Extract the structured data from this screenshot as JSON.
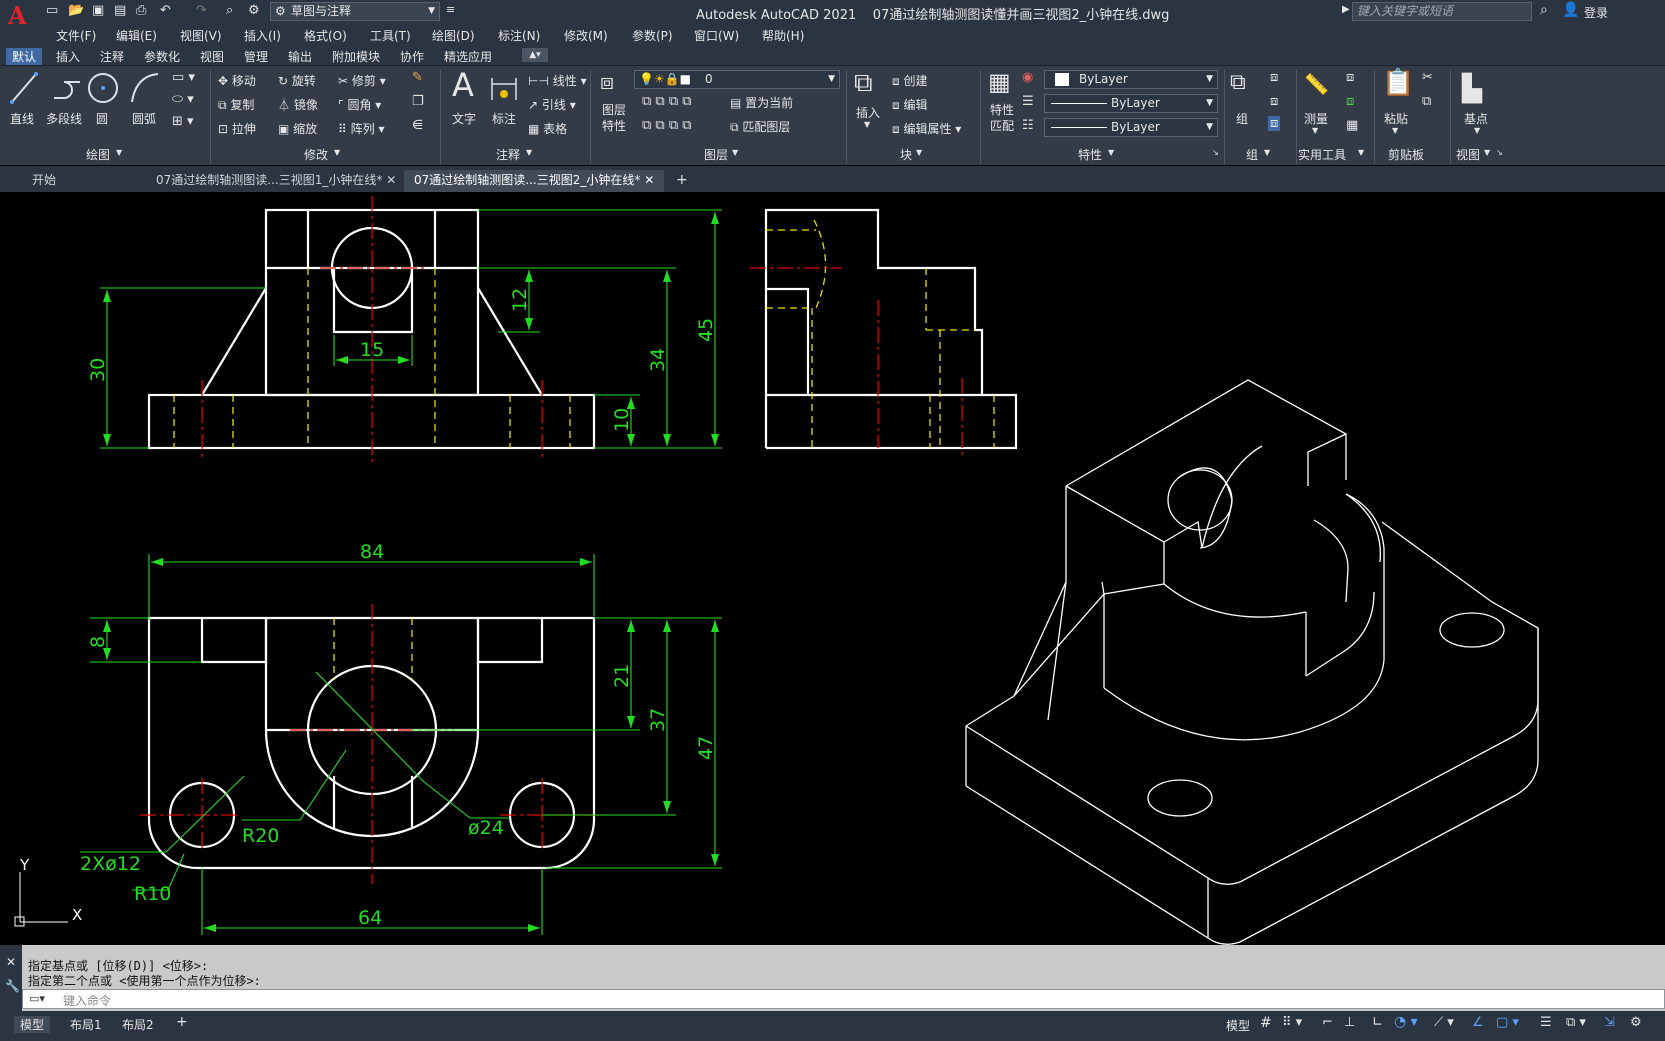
{
  "titlebar": {
    "workspace": "草图与注释",
    "title": "Autodesk AutoCAD 2021    07通过绘制轴测图读懂并画三视图2_小钟在线.dwg",
    "search_placeholder": "键入关键字或短语",
    "login": "登录"
  },
  "menu": [
    "文件(F)",
    "编辑(E)",
    "视图(V)",
    "插入(I)",
    "格式(O)",
    "工具(T)",
    "绘图(D)",
    "标注(N)",
    "修改(M)",
    "参数(P)",
    "窗口(W)",
    "帮助(H)"
  ],
  "ribbon_tabs": [
    "默认",
    "插入",
    "注释",
    "参数化",
    "视图",
    "管理",
    "输出",
    "附加模块",
    "协作",
    "精选应用"
  ],
  "ribbon": {
    "draw": {
      "line": "直线",
      "polyline": "多段线",
      "circle": "圆",
      "arc": "圆弧",
      "title": "绘图"
    },
    "modify": {
      "move": "移动",
      "rotate": "旋转",
      "trim": "修剪",
      "copy": "复制",
      "mirror": "镜像",
      "fillet": "圆角",
      "stretch": "拉伸",
      "scale": "缩放",
      "array": "阵列",
      "title": "修改"
    },
    "annotation": {
      "text": "文字",
      "dim": "标注",
      "linetype": "线性",
      "leader": "引线",
      "table": "表格",
      "title": "注释"
    },
    "layers": {
      "props": "图层\n特性",
      "current_layer": "0",
      "set_current": "置为当前",
      "match": "匹配图层",
      "title": "图层"
    },
    "block": {
      "insert": "插入",
      "create": "创建",
      "edit": "编辑",
      "edit_attr": "编辑属性",
      "title": "块"
    },
    "properties": {
      "match": "特性\n匹配",
      "color": "ByLayer",
      "linetype": "ByLayer",
      "lineweight": "ByLayer",
      "title": "特性"
    },
    "group": {
      "label": "组",
      "title": "组"
    },
    "utilities": {
      "measure": "测量",
      "title": "实用工具"
    },
    "clipboard": {
      "paste": "粘贴",
      "title": "剪贴板"
    },
    "view": {
      "base": "基点",
      "title": "视图"
    }
  },
  "doc_tabs": [
    "开始",
    "07通过绘制轴测图读...三视图1_小钟在线*",
    "07通过绘制轴测图读...三视图2_小钟在线*"
  ],
  "drawing": {
    "dims": {
      "d12": "12",
      "d15": "15",
      "d30": "30",
      "d34": "34",
      "d45": "45",
      "d10": "10",
      "d84": "84",
      "d8": "8",
      "d21": "21",
      "d37": "37",
      "d47": "47",
      "r20": "R20",
      "phi24": "ø24",
      "two_phi12": "2Xø12",
      "r10": "R10",
      "d64": "64"
    },
    "ucs": {
      "x": "X",
      "y": "Y"
    }
  },
  "command": {
    "line1": "指定基点或 [位移(D)] <位移>:",
    "line2": "指定第二个点或 <使用第一个点作为位移>:",
    "placeholder": "键入命令"
  },
  "status": {
    "tabs": [
      "模型",
      "布局1",
      "布局2"
    ]
  },
  "colors": {
    "dim": "#22dd22",
    "hidden": "#e8e000",
    "center": "#e00000",
    "object": "#ffffff",
    "accent": "#3f6aa3"
  }
}
